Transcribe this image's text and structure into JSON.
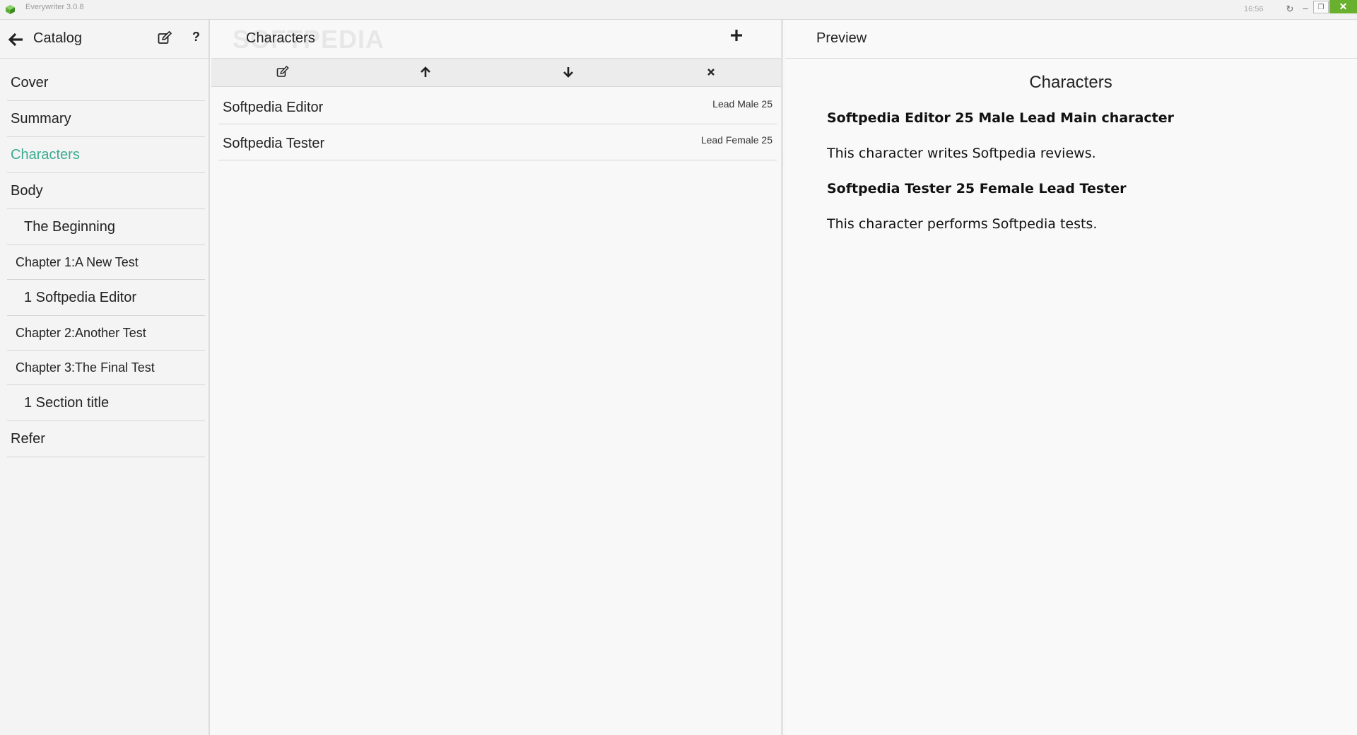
{
  "window": {
    "title": "Everywriter  3.0.8",
    "clock": "16:56",
    "brand_color": "#6ab02f"
  },
  "catalog": {
    "title": "Catalog",
    "icons": {
      "back": "arrow-left-icon",
      "edit": "edit-icon",
      "help": "?"
    },
    "items": [
      {
        "label": "Cover",
        "level": "top",
        "active": false
      },
      {
        "label": "Summary",
        "level": "top",
        "active": false
      },
      {
        "label": "Characters",
        "level": "top",
        "active": true
      },
      {
        "label": "Body",
        "level": "top",
        "active": false
      },
      {
        "label": "The Beginning",
        "level": "sub",
        "active": false
      },
      {
        "label": "Chapter 1:A New Test",
        "level": "chapter",
        "active": false
      },
      {
        "label": "1 Softpedia Editor",
        "level": "section",
        "active": false
      },
      {
        "label": "Chapter 2:Another Test",
        "level": "chapter",
        "active": false
      },
      {
        "label": "Chapter 3:The Final Test",
        "level": "chapter",
        "active": false
      },
      {
        "label": "1 Section title",
        "level": "section",
        "active": false
      },
      {
        "label": "Refer",
        "level": "top",
        "active": false
      }
    ],
    "active_color": "#3bab8f"
  },
  "characters": {
    "title": "Characters",
    "watermark": "SOFTPEDIA",
    "list": [
      {
        "name": "Softpedia Editor",
        "meta": "Lead Male 25"
      },
      {
        "name": "Softpedia Tester",
        "meta": "Lead Female 25"
      }
    ]
  },
  "preview": {
    "title": "Preview",
    "heading": "Characters",
    "entries": [
      {
        "header": "Softpedia Editor 25 Male Lead Main character",
        "text": "This character writes Softpedia reviews."
      },
      {
        "header": "Softpedia Tester 25 Female Lead Tester",
        "text": "This character performs Softpedia tests."
      }
    ]
  }
}
